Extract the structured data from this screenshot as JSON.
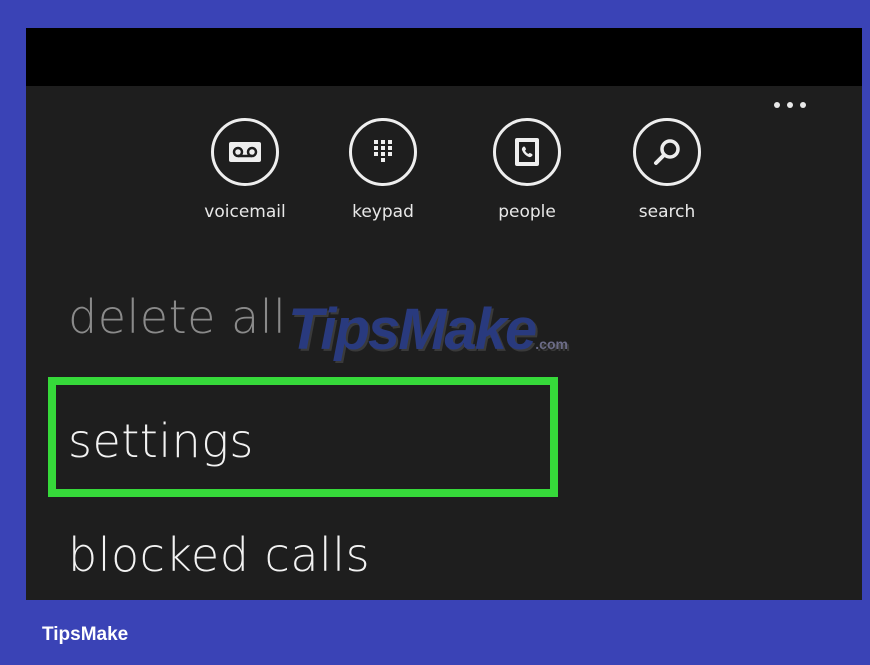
{
  "app_bar": {
    "buttons": [
      {
        "label": "voicemail",
        "icon": "voicemail-icon"
      },
      {
        "label": "keypad",
        "icon": "keypad-icon"
      },
      {
        "label": "people",
        "icon": "people-icon"
      },
      {
        "label": "search",
        "icon": "search-icon"
      }
    ],
    "more_icon": "ellipsis-icon"
  },
  "menu": {
    "items": [
      {
        "label": "delete all",
        "state": "disabled"
      },
      {
        "label": "settings",
        "state": "highlighted"
      },
      {
        "label": "blocked calls",
        "state": "normal"
      }
    ]
  },
  "watermark": {
    "text": "TipsMake",
    "suffix": ".com"
  },
  "footer": {
    "brand": "TipsMake"
  },
  "colors": {
    "page_background": "#3a43b6",
    "screen_background": "#1e1e1e",
    "highlight": "#36d93a",
    "text_primary": "#f2f2f2",
    "text_disabled": "#8a8a8a"
  }
}
